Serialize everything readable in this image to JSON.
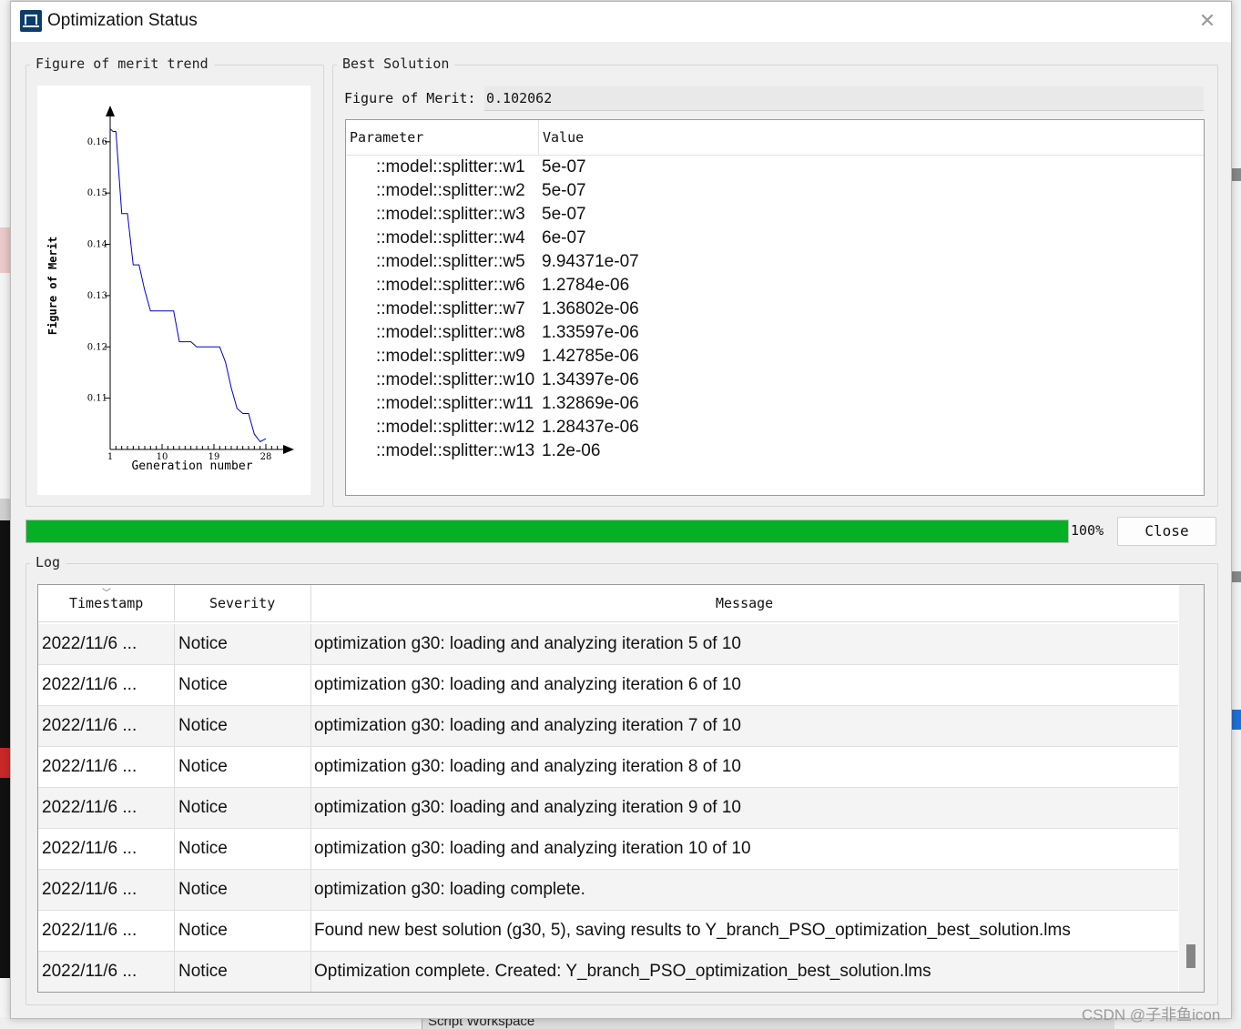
{
  "window": {
    "title": "Optimization Status",
    "close_glyph": "✕"
  },
  "trend": {
    "group_label": "Figure of merit trend"
  },
  "chart_data": {
    "type": "line",
    "xlabel": "Generation number",
    "ylabel": "Figure of Merit",
    "x_ticks": [
      "1",
      "10",
      "19",
      "28"
    ],
    "y_ticks": [
      "0.11",
      "0.12",
      "0.13",
      "0.14",
      "0.15",
      "0.16"
    ],
    "xlim": [
      1,
      31
    ],
    "ylim": [
      0.1,
      0.166
    ],
    "color": "#0000c8",
    "x": [
      1,
      1.5,
      2,
      3,
      4,
      5,
      6,
      7,
      8,
      9,
      10,
      11,
      12,
      13,
      14,
      15,
      16,
      17,
      18,
      19,
      20,
      21,
      22,
      23,
      24,
      25,
      26,
      27,
      28
    ],
    "y": [
      0.1625,
      0.162,
      0.162,
      0.146,
      0.146,
      0.136,
      0.136,
      0.131,
      0.127,
      0.127,
      0.127,
      0.127,
      0.127,
      0.121,
      0.121,
      0.121,
      0.12,
      0.12,
      0.12,
      0.12,
      0.12,
      0.117,
      0.112,
      0.108,
      0.107,
      0.107,
      0.103,
      0.1015,
      0.1021
    ]
  },
  "best": {
    "group_label": "Best Solution",
    "fom_label": "Figure of Merit:",
    "fom_value": "0.102062",
    "col_param": "Parameter",
    "col_value": "Value",
    "params": [
      {
        "name": "::model::splitter::w1",
        "value": "5e-07"
      },
      {
        "name": "::model::splitter::w2",
        "value": "5e-07"
      },
      {
        "name": "::model::splitter::w3",
        "value": "5e-07"
      },
      {
        "name": "::model::splitter::w4",
        "value": "6e-07"
      },
      {
        "name": "::model::splitter::w5",
        "value": "9.94371e-07"
      },
      {
        "name": "::model::splitter::w6",
        "value": "1.2784e-06"
      },
      {
        "name": "::model::splitter::w7",
        "value": "1.36802e-06"
      },
      {
        "name": "::model::splitter::w8",
        "value": "1.33597e-06"
      },
      {
        "name": "::model::splitter::w9",
        "value": "1.42785e-06"
      },
      {
        "name": "::model::splitter::w10",
        "value": "1.34397e-06"
      },
      {
        "name": "::model::splitter::w11",
        "value": "1.32869e-06"
      },
      {
        "name": "::model::splitter::w12",
        "value": "1.28437e-06"
      },
      {
        "name": "::model::splitter::w13",
        "value": "1.2e-06"
      }
    ]
  },
  "progress": {
    "percent_text": "100%",
    "fraction": 1.0,
    "color": "#06b025"
  },
  "close_button": "Close",
  "log": {
    "group_label": "Log",
    "col_timestamp": "Timestamp",
    "col_severity": "Severity",
    "col_message": "Message",
    "rows": [
      {
        "ts": "2022/11/6 ...",
        "sev": "Notice",
        "msg": "optimization g30: loading and analyzing iteration 5 of 10"
      },
      {
        "ts": "2022/11/6 ...",
        "sev": "Notice",
        "msg": "optimization g30: loading and analyzing iteration 6 of 10"
      },
      {
        "ts": "2022/11/6 ...",
        "sev": "Notice",
        "msg": "optimization g30: loading and analyzing iteration 7 of 10"
      },
      {
        "ts": "2022/11/6 ...",
        "sev": "Notice",
        "msg": "optimization g30: loading and analyzing iteration 8 of 10"
      },
      {
        "ts": "2022/11/6 ...",
        "sev": "Notice",
        "msg": "optimization g30: loading and analyzing iteration 9 of 10"
      },
      {
        "ts": "2022/11/6 ...",
        "sev": "Notice",
        "msg": "optimization g30: loading and analyzing iteration 10 of 10"
      },
      {
        "ts": "2022/11/6 ...",
        "sev": "Notice",
        "msg": "optimization g30: loading complete."
      },
      {
        "ts": "2022/11/6 ...",
        "sev": "Notice",
        "msg": "Found new best solution (g30, 5), saving results to Y_branch_PSO_optimization_best_solution.lms"
      },
      {
        "ts": "2022/11/6 ...",
        "sev": "Notice",
        "msg": "Optimization complete. Created: Y_branch_PSO_optimization_best_solution.lms"
      }
    ]
  },
  "background": {
    "workspace_tab": "Script Workspace"
  },
  "watermark": "CSDN @子非鱼icon"
}
